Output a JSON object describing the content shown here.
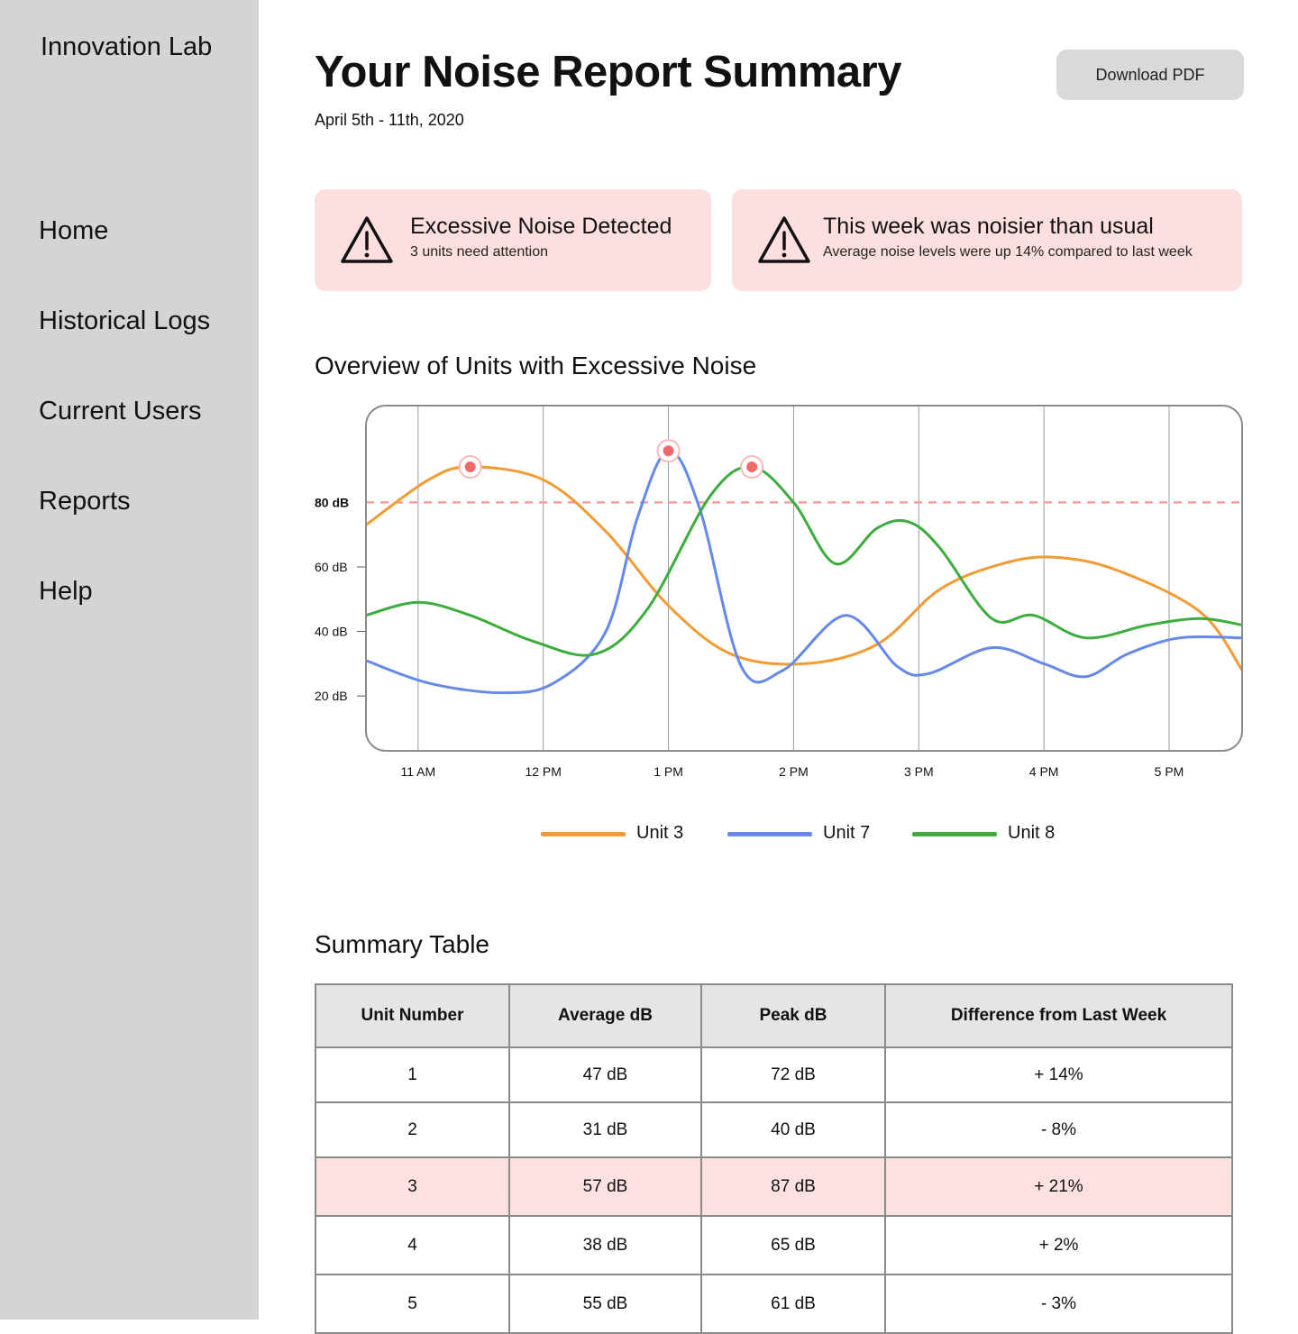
{
  "sidebar": {
    "brand": "Innovation Lab",
    "items": [
      {
        "label": "Home"
      },
      {
        "label": "Historical Logs"
      },
      {
        "label": "Current Users"
      },
      {
        "label": "Reports"
      },
      {
        "label": "Help"
      }
    ]
  },
  "header": {
    "title": "Your Noise Report Summary",
    "date_range": "April 5th - 11th, 2020",
    "download_label": "Download PDF"
  },
  "alerts": [
    {
      "icon": "warning-icon",
      "title": "Excessive Noise Detected",
      "subtitle": "3 units need attention"
    },
    {
      "icon": "warning-icon",
      "title": "This week was noisier than usual",
      "subtitle": "Average noise levels were up 14% compared to last week"
    }
  ],
  "chart_section": {
    "title": "Overview of Units with Excessive Noise"
  },
  "chart_data": {
    "type": "line",
    "title": "Overview of Units with Excessive Noise",
    "xlabel": "",
    "ylabel": "",
    "x_ticks": [
      "11 AM",
      "12 PM",
      "1 PM",
      "2 PM",
      "3 PM",
      "4 PM",
      "5 PM"
    ],
    "y_ticks": [
      "20 dB",
      "40 dB",
      "60 dB",
      "80 dB"
    ],
    "y_tick_values": [
      20,
      40,
      60,
      80
    ],
    "x_range": [
      "10:35 AM",
      "5:35 PM"
    ],
    "ylim": [
      3,
      110
    ],
    "threshold": {
      "label": "80 dB",
      "value": 80,
      "style": "dashed",
      "color": "#f4a0a0"
    },
    "grid": "vertical",
    "legend_position": "bottom-center",
    "series": [
      {
        "name": "Unit 3",
        "color": "#f39a32",
        "points": [
          [
            "10:35 AM",
            73
          ],
          [
            "11:05 AM",
            87
          ],
          [
            "11:25 AM",
            91
          ],
          [
            "12:00 PM",
            87
          ],
          [
            "12:30 PM",
            71
          ],
          [
            "1:00 PM",
            48
          ],
          [
            "1:30 PM",
            33
          ],
          [
            "2:05 PM",
            30
          ],
          [
            "2:40 PM",
            36
          ],
          [
            "3:10 PM",
            53
          ],
          [
            "3:40 PM",
            61
          ],
          [
            "4:05 PM",
            63
          ],
          [
            "4:35 PM",
            59
          ],
          [
            "5:15 PM",
            46
          ],
          [
            "5:35 PM",
            28
          ]
        ],
        "peaks": [
          [
            "11:25 AM",
            91
          ]
        ]
      },
      {
        "name": "Unit 7",
        "color": "#6488eb",
        "points": [
          [
            "10:35 AM",
            31
          ],
          [
            "11:05 AM",
            24
          ],
          [
            "11:40 AM",
            21
          ],
          [
            "12:05 PM",
            24
          ],
          [
            "12:30 PM",
            40
          ],
          [
            "12:45 PM",
            75
          ],
          [
            "1:00 PM",
            96
          ],
          [
            "1:15 PM",
            78
          ],
          [
            "1:35 PM",
            29
          ],
          [
            "1:55 PM",
            28
          ],
          [
            "2:25 PM",
            45
          ],
          [
            "2:50 PM",
            29
          ],
          [
            "3:05 PM",
            27
          ],
          [
            "3:35 PM",
            35
          ],
          [
            "4:00 PM",
            30
          ],
          [
            "4:20 PM",
            26
          ],
          [
            "4:40 PM",
            33
          ],
          [
            "5:05 PM",
            38
          ],
          [
            "5:35 PM",
            38
          ]
        ],
        "peaks": [
          [
            "1:00 PM",
            96
          ]
        ]
      },
      {
        "name": "Unit 8",
        "color": "#3cad3c",
        "points": [
          [
            "10:35 AM",
            45
          ],
          [
            "11:00 AM",
            49
          ],
          [
            "11:25 AM",
            45
          ],
          [
            "11:55 AM",
            37
          ],
          [
            "12:25 PM",
            33
          ],
          [
            "12:50 PM",
            47
          ],
          [
            "1:20 PM",
            82
          ],
          [
            "1:40 PM",
            91
          ],
          [
            "2:00 PM",
            80
          ],
          [
            "2:20 PM",
            61
          ],
          [
            "2:40 PM",
            72
          ],
          [
            "2:55 PM",
            74
          ],
          [
            "3:10 PM",
            66
          ],
          [
            "3:35 PM",
            44
          ],
          [
            "3:55 PM",
            45
          ],
          [
            "4:20 PM",
            38
          ],
          [
            "4:50 PM",
            42
          ],
          [
            "5:15 PM",
            44
          ],
          [
            "5:35 PM",
            42
          ]
        ],
        "peaks": [
          [
            "1:40 PM",
            91
          ]
        ]
      }
    ]
  },
  "table": {
    "title": "Summary Table",
    "headers": [
      "Unit Number",
      "Average dB",
      "Peak dB",
      "Difference from Last Week"
    ],
    "rows": [
      {
        "unit": "1",
        "avg": "47 dB",
        "peak": "72 dB",
        "diff": "+ 14%",
        "trend": "up"
      },
      {
        "unit": "2",
        "avg": "31 dB",
        "peak": "40 dB",
        "diff": "- 8%",
        "trend": "down"
      },
      {
        "unit": "3",
        "avg": "57 dB",
        "peak": "87 dB",
        "diff": "+ 21%",
        "trend": "up",
        "highlight": true
      },
      {
        "unit": "4",
        "avg": "38 dB",
        "peak": "65 dB",
        "diff": "+ 2%",
        "trend": "up"
      },
      {
        "unit": "5",
        "avg": "55 dB",
        "peak": "61 dB",
        "diff": "- 3%",
        "trend": "down"
      }
    ]
  },
  "colors": {
    "sidebar_bg": "#d4d4d4",
    "alert_bg": "#fddfdf",
    "positive_change": "#d42a2a",
    "negative_change": "#3fae3a",
    "highlight_row": "#fde1e1"
  }
}
